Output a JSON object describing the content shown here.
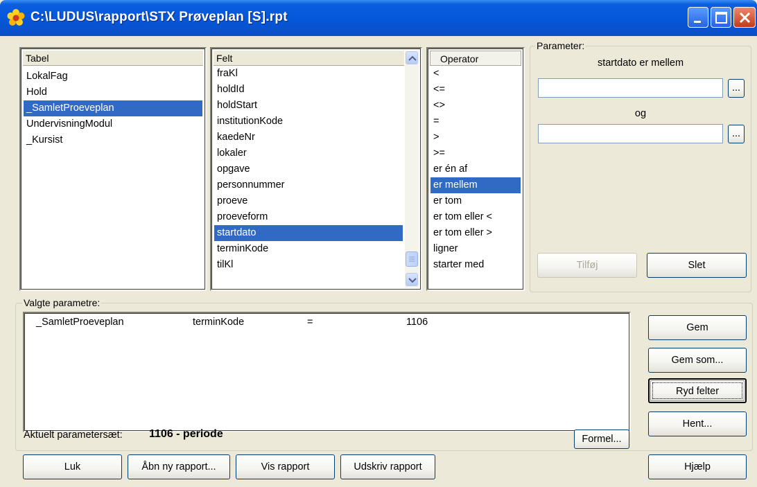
{
  "window": {
    "title": "C:\\LUDUS\\rapport\\STX Prøveplan [S].rpt",
    "icon": "flower-app-icon",
    "controls": [
      "minimize-icon",
      "maximize-icon",
      "close-icon"
    ]
  },
  "tabel": {
    "header": "Tabel",
    "items": [
      "LokalFag",
      "Hold",
      "_SamletProeveplan",
      "UndervisningModul",
      "_Kursist"
    ],
    "selected": "_SamletProeveplan"
  },
  "felt": {
    "header": "Felt",
    "items": [
      "fraKl",
      "holdId",
      "holdStart",
      "institutionKode",
      "kaedeNr",
      "lokaler",
      "opgave",
      "personnummer",
      "proeve",
      "proeveform",
      "startdato",
      "terminKode",
      "tilKl"
    ],
    "selected": "startdato"
  },
  "operator": {
    "header": "Operator",
    "items": [
      "<",
      "<=",
      "<>",
      "=",
      ">",
      ">=",
      "er én af",
      "er mellem",
      "er tom",
      "er tom eller <",
      "er tom eller >",
      "ligner",
      "starter med"
    ],
    "selected": "er mellem"
  },
  "parameter": {
    "group_label": "Parameter:",
    "caption": "startdato er mellem",
    "og_label": "og",
    "value1": "",
    "value2": "",
    "browse_label": "...",
    "tilfoej_label": "Tilføj",
    "slet_label": "Slet"
  },
  "valgte": {
    "group_label": "Valgte parametre:",
    "rows": [
      {
        "tabel": "_SamletProeveplan",
        "felt": "terminKode",
        "operator": "=",
        "vaerdi": "1106"
      }
    ],
    "aktuelt_label": "Aktuelt parametersæt:",
    "aktuelt_value": "1106 - periode",
    "formel_label": "Formel..."
  },
  "side_buttons": {
    "gem": "Gem",
    "gem_som": "Gem som...",
    "ryd_felter": "Ryd felter",
    "hent": "Hent..."
  },
  "bottom_buttons": {
    "luk": "Luk",
    "aabn": "Åbn ny rapport...",
    "vis": "Vis rapport",
    "udskriv": "Udskriv rapport",
    "hjaelp": "Hjælp"
  }
}
